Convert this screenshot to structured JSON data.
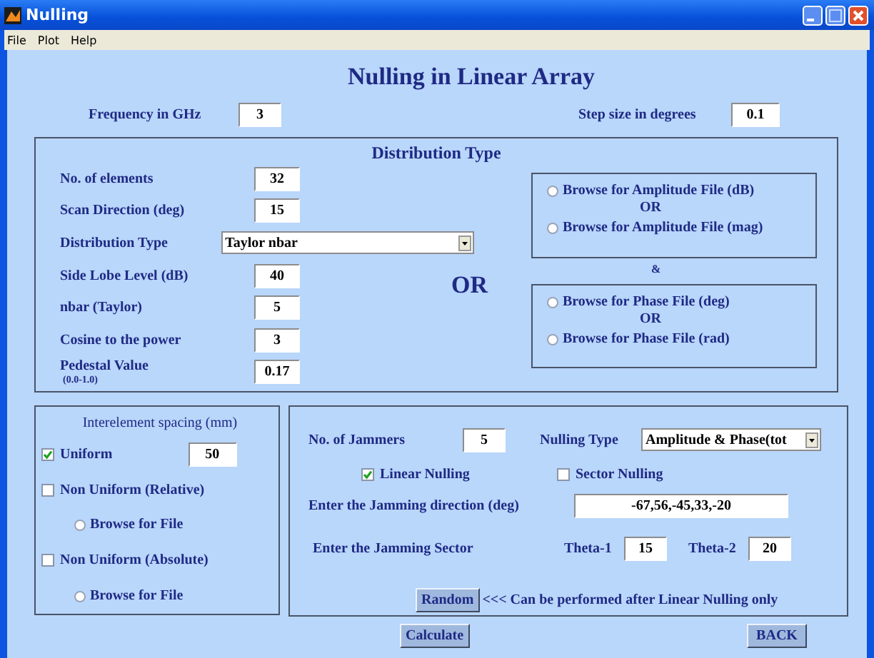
{
  "window": {
    "title": "Nulling"
  },
  "menu": [
    "File",
    "Plot",
    "Help"
  ],
  "heading": "Nulling in Linear Array",
  "frequency": {
    "label": "Frequency in GHz",
    "value": "3"
  },
  "step_size": {
    "label": "Step size in degrees",
    "value": "0.1"
  },
  "distribution_panel": {
    "title": "Distribution Type",
    "fields": [
      {
        "kind": "input",
        "label": "No. of elements",
        "value": "32"
      },
      {
        "kind": "input",
        "label": "Scan Direction (deg)",
        "value": "15"
      },
      {
        "kind": "select",
        "label": "Distribution Type",
        "value": "Taylor nbar"
      },
      {
        "kind": "input",
        "label": "Side Lobe Level (dB)",
        "value": "40"
      },
      {
        "kind": "input",
        "label": "nbar (Taylor)",
        "value": "5"
      },
      {
        "kind": "input",
        "label": "Cosine to the power",
        "value": "3"
      },
      {
        "kind": "input",
        "label": "Pedestal Value",
        "sublabel": "(0.0-1.0)",
        "value": "0.17"
      }
    ],
    "or_label": "OR",
    "amplitude_options": [
      {
        "label": "Browse for Amplitude File (dB)",
        "selected": false
      },
      {
        "label": "Browse for Amplitude File (mag)",
        "selected": false
      }
    ],
    "amplitude_or": "OR",
    "and_label": "&",
    "phase_options": [
      {
        "label": "Browse for Phase File (deg)",
        "selected": false
      },
      {
        "label": "Browse for Phase File (rad)",
        "selected": false
      }
    ],
    "phase_or": "OR"
  },
  "spacing_panel": {
    "title": "Interelement spacing (mm)",
    "uniform": {
      "label": "Uniform",
      "checked": true,
      "value": "50"
    },
    "options": [
      {
        "label": "Non Uniform (Relative)",
        "checked": false,
        "browse": {
          "label": "Browse for File",
          "selected": false
        }
      },
      {
        "label": "Non Uniform (Absolute)",
        "checked": false,
        "browse": {
          "label": "Browse for File",
          "selected": false
        }
      }
    ]
  },
  "jammer_panel": {
    "count_label": "No. of Jammers",
    "count": "5",
    "nulling_type_label": "Nulling Type",
    "nulling_type": "Amplitude & Phase(tot",
    "linear": {
      "label": "Linear Nulling",
      "checked": true
    },
    "sector": {
      "label": "Sector Nulling",
      "checked": false
    },
    "direction_label": "Enter the Jamming direction (deg)",
    "direction": "-67,56,-45,33,-20",
    "sector_label": "Enter the Jamming Sector",
    "theta1_label": "Theta-1",
    "theta1": "15",
    "theta2_label": "Theta-2",
    "theta2": "20",
    "random_button": "Random",
    "random_note": "<<< Can be performed after Linear Nulling only"
  },
  "buttons": {
    "calculate": "Calculate",
    "back": "BACK"
  }
}
